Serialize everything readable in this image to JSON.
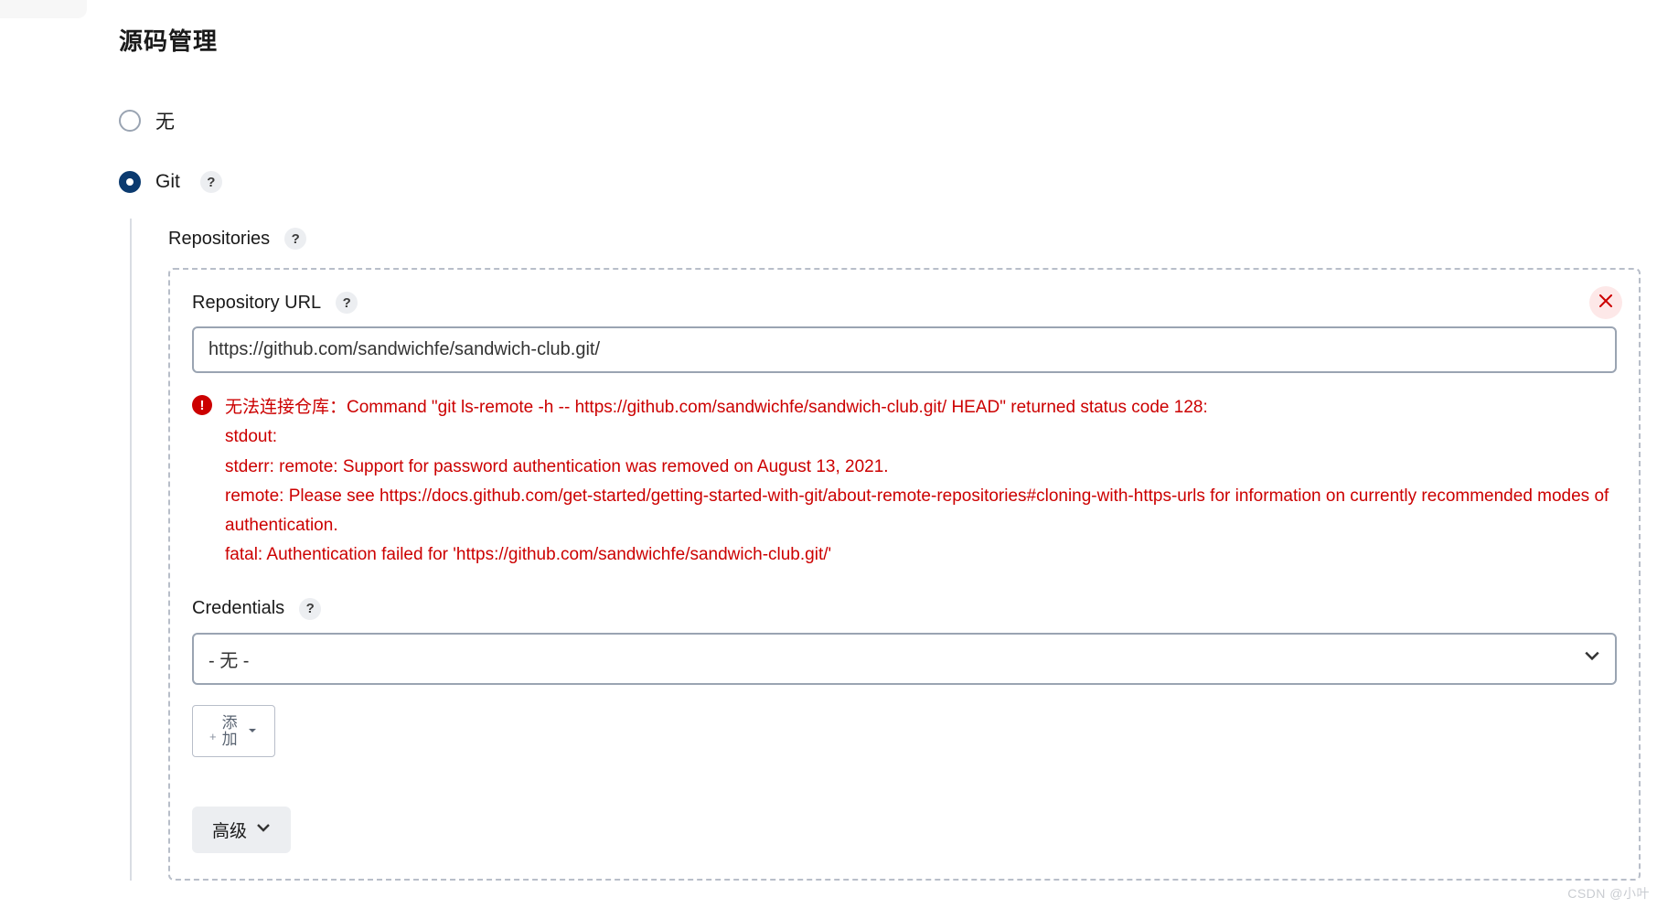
{
  "section_title": "源码管理",
  "radio_none_label": "无",
  "radio_git_label": "Git",
  "repositories_label": "Repositories",
  "repo_url_label": "Repository URL",
  "repo_url_value": "https://github.com/sandwichfe/sandwich-club.git/",
  "error_message": "无法连接仓库：Command \"git ls-remote -h -- https://github.com/sandwichfe/sandwich-club.git/ HEAD\" returned status code 128:\nstdout:\nstderr: remote: Support for password authentication was removed on August 13, 2021.\nremote: Please see https://docs.github.com/get-started/getting-started-with-git/about-remote-repositories#cloning-with-https-urls for information on currently recommended modes of authentication.\nfatal: Authentication failed for 'https://github.com/sandwichfe/sandwich-club.git/'",
  "credentials_label": "Credentials",
  "credentials_selected": "- 无 -",
  "add_button_char1": "添",
  "add_button_char2": "加",
  "advanced_button_label": "高级",
  "help_glyph": "?",
  "error_glyph": "!",
  "watermark": "CSDN @小叶"
}
